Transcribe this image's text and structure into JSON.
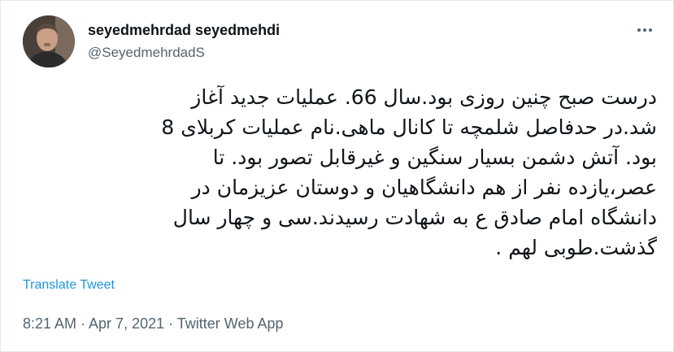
{
  "tweet": {
    "author": {
      "name": "seyedmehrdad seyedmehdi",
      "handle": "@SeyedmehrdadS"
    },
    "more_icon": "more-horizontal-icon",
    "text_lines": [
      "درست صبح چنین روزی بود.سال 66. عملیات جدید آغاز",
      "شد.در حدفاصل شلمچه تا کانال ماهی.نام عملیات کربلای 8",
      "بود. آتش دشمن بسیار سنگین و غیرقابل تصور بود. تا",
      "عصر،یازده نفر از هم دانشگاهیان و دوستان عزیزمان در",
      "دانشگاه امام صادق ع به شهادت رسیدند.سی و چهار سال",
      "گذشت.طوبی لهم ."
    ],
    "translate_label": "Translate Tweet",
    "meta": "8:21 AM · Apr 7, 2021 · Twitter Web App"
  },
  "colors": {
    "text": "#0f1419",
    "secondary": "#536471",
    "link": "#1b95e0",
    "border": "#e1e8ed"
  }
}
